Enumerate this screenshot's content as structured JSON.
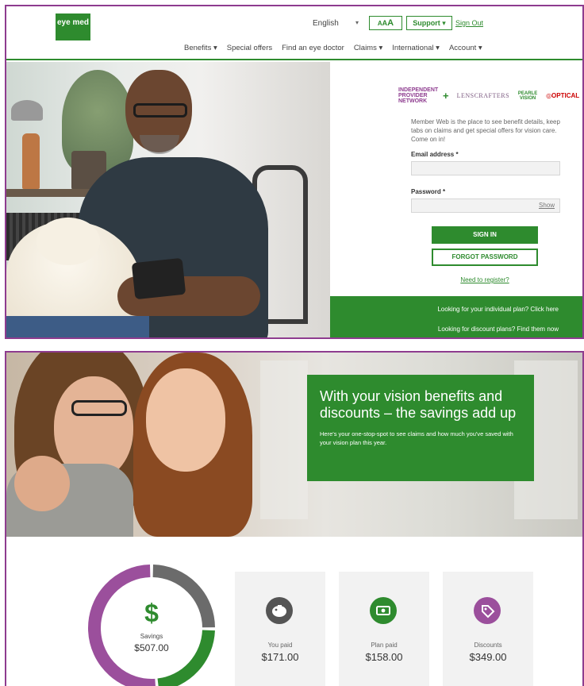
{
  "header": {
    "logo_text": "eye med",
    "language": "English",
    "text_size_label": "AAA",
    "support_label": "Support ▾",
    "sign_out": "Sign Out"
  },
  "nav": [
    {
      "label": "Benefits ▾"
    },
    {
      "label": "Special offers"
    },
    {
      "label": "Find an eye doctor"
    },
    {
      "label": "Claims ▾"
    },
    {
      "label": "International ▾"
    },
    {
      "label": "Account ▾"
    }
  ],
  "partners": {
    "ipn": "INDEPENDENT PROVIDER NETWORK",
    "plus": "+",
    "lenscrafters": "LENSCRAFTERS",
    "pearle": "PEARLE VISION",
    "target": "OPTICAL"
  },
  "login": {
    "intro": "Member Web is the place to see benefit details, keep tabs on claims and get special offers for vision care.  Come on in!",
    "email_label": "Email address *",
    "email_value": "",
    "password_label": "Password *",
    "password_value": "",
    "show_label": "Show",
    "sign_in": "SIGN IN",
    "forgot": "FORGOT PASSWORD",
    "register": "Need to register?",
    "individual_plan": "Looking for your individual plan? Click here",
    "discount_plans": "Looking for discount plans? Find them now"
  },
  "promo": {
    "headline": "With your vision benefits and discounts – the savings add up",
    "body": "Here's your one-stop-spot to see claims and how much you've saved with your vision plan this year."
  },
  "savings": {
    "symbol": "$",
    "label": "Savings",
    "value": "$507.00",
    "segments": [
      {
        "name": "Discounts",
        "amount": 349,
        "color": "#9b4f9c"
      },
      {
        "name": "You paid",
        "amount": 171,
        "color": "#6b6b6b"
      },
      {
        "name": "Plan paid",
        "amount": 158,
        "color": "#2e8b2e"
      }
    ]
  },
  "cards": [
    {
      "label": "You paid",
      "value": "$171.00",
      "icon": "piggy-bank-icon",
      "color": "#555555"
    },
    {
      "label": "Plan paid",
      "value": "$158.00",
      "icon": "money-icon",
      "color": "#2e8b2e"
    },
    {
      "label": "Discounts",
      "value": "$349.00",
      "icon": "tag-icon",
      "color": "#9b4f9c"
    }
  ]
}
